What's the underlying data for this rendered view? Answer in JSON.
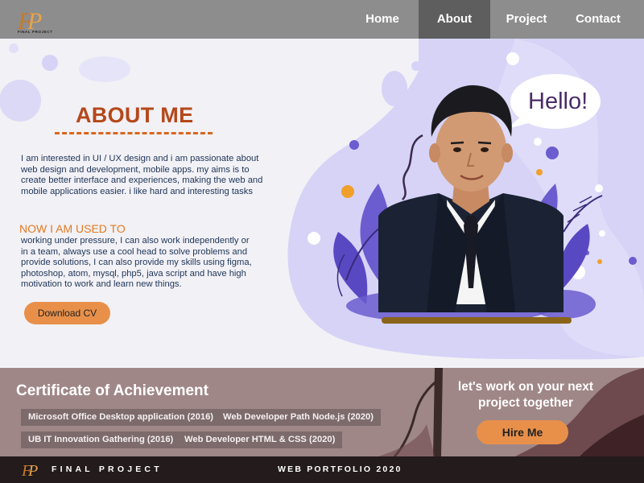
{
  "brand": {
    "logo_letters": "FP",
    "logo_caption": "FINAL PROJECT"
  },
  "nav": {
    "items": [
      {
        "label": "Home"
      },
      {
        "label": "About"
      },
      {
        "label": "Project"
      },
      {
        "label": "Contact"
      }
    ],
    "active": "About"
  },
  "hero": {
    "title": "ABOUT ME",
    "paragraph_1": "I am interested in UI / UX design and i am passionate about web design and development, mobile apps. my aims is to create better interface and experiences, making the web and mobile applications easier. i like hard and interesting tasks",
    "subtitle": "NOW I AM USED TO",
    "paragraph_2": "working under pressure, I can also work independently or in a team, always use a cool head to solve problems and provide solutions, I can also provide my skills using figma, photoshop, atom, mysql, php5, java script and have high  motivation to work and learn new things.",
    "download_button": "Download CV",
    "speech_bubble": "Hello!"
  },
  "certificates": {
    "title": "Certificate of Achievement",
    "items": [
      {
        "label": "Microsoft Office Desktop application (2016)"
      },
      {
        "label": "Web Developer Path Node.js (2020)"
      },
      {
        "label": "UB IT Innovation Gathering (2016)"
      },
      {
        "label": "Web Developer HTML & CSS (2020)"
      }
    ]
  },
  "cta": {
    "text": "let's work on your next project together",
    "button": "Hire Me"
  },
  "footer": {
    "brand": "FINAL PROJECT",
    "tagline": "WEB PORTFOLIO 2020"
  },
  "colors": {
    "nav_bg": "#8d8d8d",
    "nav_active": "#5e5e5e",
    "accent_orange": "#e8904a",
    "title_color": "#b5481a",
    "blob_lavender": "#cfcbf5",
    "cert_bg": "#a08787",
    "footer_bg": "#231b1c"
  }
}
